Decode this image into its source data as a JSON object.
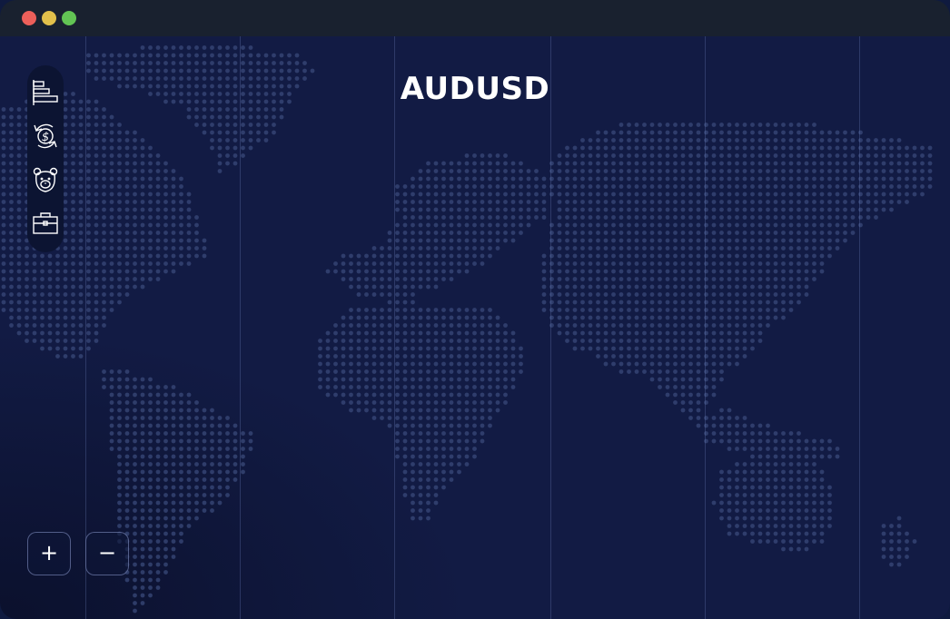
{
  "window": {
    "traffic_lights": [
      {
        "name": "close",
        "color": "#ec5f5a"
      },
      {
        "name": "minimize",
        "color": "#e2c04b"
      },
      {
        "name": "maximize",
        "color": "#62c454"
      }
    ]
  },
  "map": {
    "title": "AUDUSD",
    "land_dot_color": "#3a4a7a",
    "timezone_line_color": "#4b5a8e"
  },
  "toolbar": {
    "items": [
      {
        "icon": "bar-chart-icon",
        "label": ""
      },
      {
        "icon": "currency-exchange-icon",
        "label": ""
      },
      {
        "icon": "bear-icon",
        "label": ""
      },
      {
        "icon": "briefcase-icon",
        "label": ""
      }
    ]
  },
  "zoom": {
    "in_label": "+",
    "out_label": "−"
  }
}
